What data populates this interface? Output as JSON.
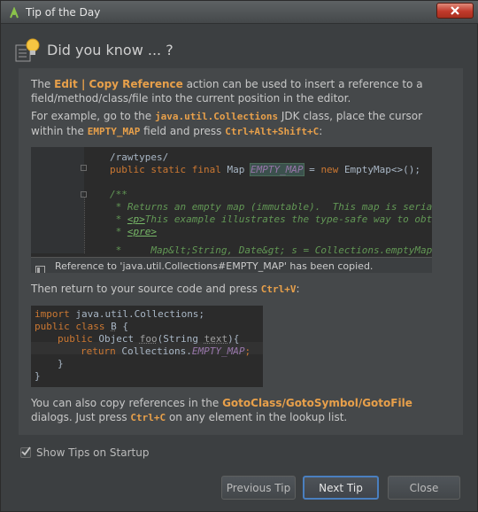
{
  "window": {
    "title": "Tip of the Day"
  },
  "header": {
    "title": "Did you know ... ?"
  },
  "tip": {
    "p1": {
      "a": "The ",
      "b": "Edit | Copy Reference",
      "c": " action can be used to insert a reference to a field/method/class/file into the current position in the editor."
    },
    "p2": {
      "a": "For example, go to the ",
      "b": "java.util.Collections",
      "c": " JDK class, place the cursor within the ",
      "d": "EMPTY_MAP",
      "e": " field and press ",
      "f": "Ctrl+Alt+Shift+C",
      "g": ":"
    },
    "code1": {
      "l1": "/rawtypes/",
      "l2_kw": "public static final ",
      "l2_type": "Map ",
      "l2_field": "EMPTY_MAP",
      "l2_rest": " = ",
      "l2_new": "new ",
      "l2_end": "EmptyMap<>();",
      "l3": "/**",
      "l4": " * Returns an empty map (immutable).  This map is serial",
      "l5_a": " * ",
      "l5_tag": "<p>",
      "l5_b": "This example illustrates the type-safe way to obta",
      "l6_a": " * ",
      "l6_tag": "<pre>",
      "l7": " *     Map&lt;String, Date&gt; s = Collections.emptyMap"
    },
    "status": "Reference to 'java.util.Collections#EMPTY_MAP' has been copied.",
    "p3": {
      "a": "Then return to your source code and press ",
      "b": "Ctrl+V",
      "c": ":"
    },
    "code2": {
      "l1_kw": "import ",
      "l1_rest": "java.util.Collections;",
      "l2_kw": "public class ",
      "l2_name": "B",
      "l2_end": " {",
      "l3_kw": "public ",
      "l3_type": "Object ",
      "l3_m": "foo",
      "l3_args": "(String ",
      "l3_p": "text",
      "l3_end": "){",
      "l4_kw": "return ",
      "l4_cls": "Collections.",
      "l4_field": "EMPTY_MAP",
      "l4_end": ";",
      "l5": "}",
      "l6": "}"
    },
    "p4": {
      "a": "You can also copy references in the ",
      "b": "GotoClass/GotoSymbol/GotoFile",
      "c": " dialogs. Just press ",
      "d": "Ctrl+C",
      "e": " on any element in the lookup list."
    }
  },
  "checkbox": {
    "label": "Show Tips on Startup",
    "checked": true
  },
  "buttons": {
    "previous": "Previous Tip",
    "next": "Next Tip",
    "close": "Close"
  }
}
